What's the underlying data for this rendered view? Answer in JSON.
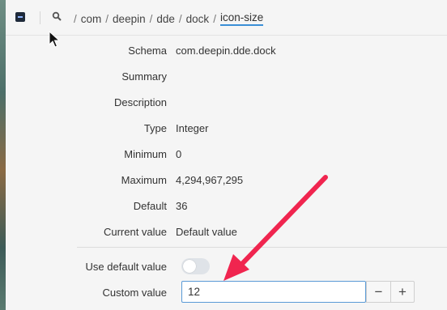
{
  "titlebar": {
    "app_icon": "dconf-editor-icon",
    "search_icon": "search-icon",
    "breadcrumbs": [
      {
        "label": "com"
      },
      {
        "label": "deepin"
      },
      {
        "label": "dde"
      },
      {
        "label": "dock"
      }
    ],
    "separator": "/",
    "current": "icon-size"
  },
  "properties": [
    {
      "label": "Schema",
      "value": "com.deepin.dde.dock"
    },
    {
      "label": "Summary",
      "value": ""
    },
    {
      "label": "Description",
      "value": ""
    },
    {
      "label": "Type",
      "value": "Integer"
    },
    {
      "label": "Minimum",
      "value": "0"
    },
    {
      "label": "Maximum",
      "value": "4,294,967,295"
    },
    {
      "label": "Default",
      "value": "36"
    },
    {
      "label": "Current value",
      "value": "Default value"
    }
  ],
  "use_default": {
    "label": "Use default value",
    "enabled": false
  },
  "custom_value": {
    "label": "Custom value",
    "value": "12",
    "minus": "−",
    "plus": "+"
  },
  "colors": {
    "accent": "#3a8fd6",
    "annotation_arrow": "#f0254f"
  }
}
